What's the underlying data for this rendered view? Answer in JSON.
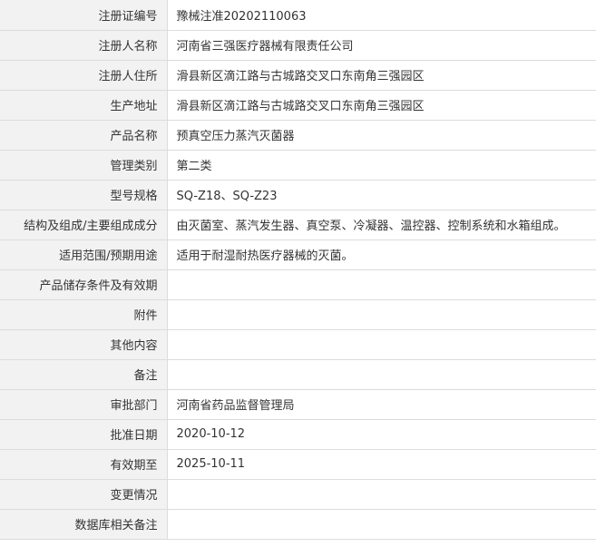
{
  "rows": [
    {
      "label": "注册证编号",
      "value": "豫械注准20202110063"
    },
    {
      "label": "注册人名称",
      "value": "河南省三强医疗器械有限责任公司"
    },
    {
      "label": "注册人住所",
      "value": "滑县新区滴江路与古城路交叉口东南角三强园区"
    },
    {
      "label": "生产地址",
      "value": "滑县新区滴江路与古城路交叉口东南角三强园区"
    },
    {
      "label": "产品名称",
      "value": "预真空压力蒸汽灭菌器"
    },
    {
      "label": "管理类别",
      "value": "第二类"
    },
    {
      "label": "型号规格",
      "value": "SQ-Z18、SQ-Z23"
    },
    {
      "label": "结构及组成/主要组成成分",
      "value": "由灭菌室、蒸汽发生器、真空泵、冷凝器、温控器、控制系统和水箱组成。"
    },
    {
      "label": "适用范围/预期用途",
      "value": "适用于耐湿耐热医疗器械的灭菌。"
    },
    {
      "label": "产品储存条件及有效期",
      "value": ""
    },
    {
      "label": "附件",
      "value": ""
    },
    {
      "label": "其他内容",
      "value": ""
    },
    {
      "label": "备注",
      "value": ""
    },
    {
      "label": "审批部门",
      "value": "河南省药品监督管理局"
    },
    {
      "label": "批准日期",
      "value": "2020-10-12"
    },
    {
      "label": "有效期至",
      "value": "2025-10-11"
    },
    {
      "label": "变更情况",
      "value": ""
    },
    {
      "label": "数据库相关备注",
      "value": ""
    }
  ]
}
